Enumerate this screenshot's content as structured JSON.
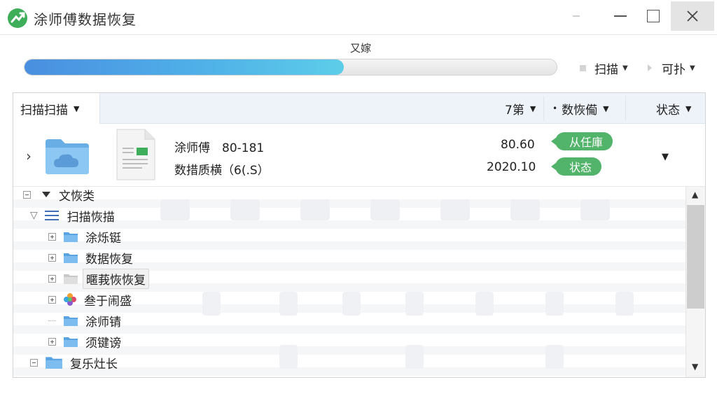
{
  "window": {
    "title": "涂师傅数据恢复"
  },
  "progress": {
    "status_text": "又嫁",
    "value": 0.6
  },
  "toolbar": {
    "scan_label": "扫描",
    "more_label": "可扑"
  },
  "columns": {
    "name": "扫描扫描",
    "date": "7第",
    "type": "数恢僃",
    "status": "状态"
  },
  "detail": {
    "name": "涂师傅　80-181",
    "subtitle": "数措质横（6(.S）",
    "size": "80.60",
    "date": "2020.10",
    "tags": [
      "从任庫",
      "状态"
    ]
  },
  "tree": {
    "root_label": "文恢类",
    "group_label": "扫描恢描",
    "items": [
      {
        "label": "涂烁铤",
        "icon": "folder-icon"
      },
      {
        "label": "数据恢复",
        "icon": "folder-icon"
      },
      {
        "label": "暱莪恢恢复",
        "icon": "folder-icon"
      },
      {
        "label": "叁于闹盛",
        "icon": "photos-icon"
      },
      {
        "label": "涂师锖",
        "icon": "folder-icon"
      },
      {
        "label": "须键谤",
        "icon": "folder-icon"
      }
    ],
    "bottom_label": "复乐灶长"
  },
  "colors": {
    "accent": "#4a8fe0",
    "tag_green": "#52b36a",
    "logo_green": "#3fae5a"
  }
}
